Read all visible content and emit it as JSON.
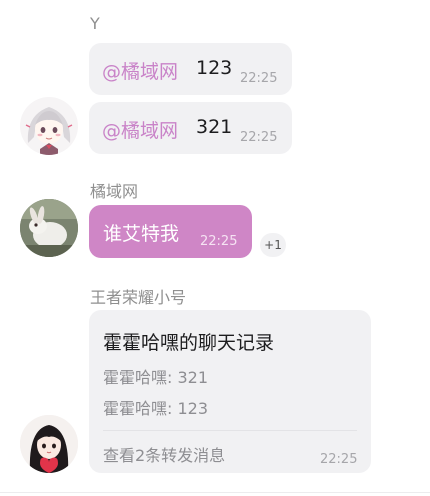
{
  "groups": [
    {
      "sender": "Y",
      "messages": [
        {
          "mention": "@橘域网",
          "text": "123",
          "time": "22:25"
        },
        {
          "mention": "@橘域网",
          "text": "321",
          "time": "22:25"
        }
      ]
    },
    {
      "sender": "橘域网",
      "messages": [
        {
          "text": "谁艾特我",
          "time": "22:25",
          "reaction": "+1"
        }
      ]
    },
    {
      "sender": "王者荣耀小号",
      "forward": {
        "title": "霍霍哈嘿的聊天记录",
        "lines": [
          "霍霍哈嘿: 321",
          "霍霍哈嘿: 123"
        ],
        "footer": "查看2条转发消息",
        "time": "22:25"
      }
    }
  ],
  "colors": {
    "mention": "#c983c8",
    "self_bubble": "#cf86c6",
    "bubble": "#f1f1f3"
  }
}
